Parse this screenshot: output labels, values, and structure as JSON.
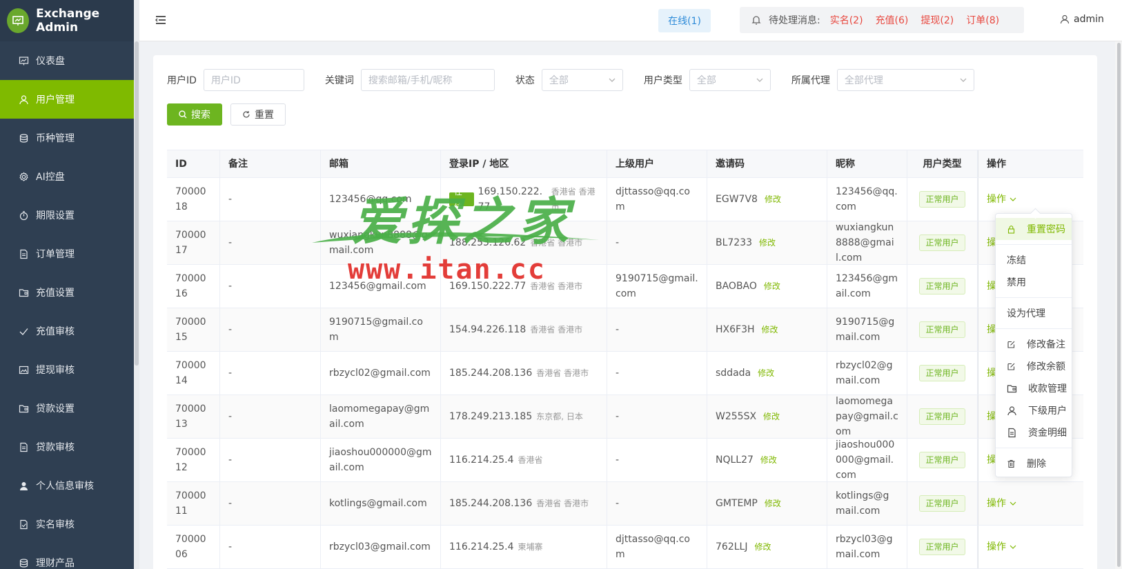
{
  "app": {
    "title": "Exchange Admin"
  },
  "sidebar": {
    "items": [
      {
        "label": "仪表盘",
        "icon": "dashboard-icon",
        "active": false
      },
      {
        "label": "用户管理",
        "icon": "user-icon",
        "active": true
      },
      {
        "label": "币种管理",
        "icon": "coin-icon",
        "active": false
      },
      {
        "label": "AI控盘",
        "icon": "gear-icon",
        "active": false
      },
      {
        "label": "期限设置",
        "icon": "stopwatch-icon",
        "active": false
      },
      {
        "label": "订单管理",
        "icon": "document-icon",
        "active": false
      },
      {
        "label": "充值设置",
        "icon": "folder-icon",
        "active": false
      },
      {
        "label": "充值审核",
        "icon": "check-icon",
        "active": false
      },
      {
        "label": "提现审核",
        "icon": "image-icon",
        "active": false
      },
      {
        "label": "贷款设置",
        "icon": "folder-icon",
        "active": false
      },
      {
        "label": "贷款审核",
        "icon": "document-icon",
        "active": false
      },
      {
        "label": "个人信息审核",
        "icon": "user-filled-icon",
        "active": false
      },
      {
        "label": "实名审核",
        "icon": "doc-check-icon",
        "active": false
      },
      {
        "label": "理财产品",
        "icon": "coin-icon",
        "active": false
      }
    ]
  },
  "header": {
    "online": "在线(1)",
    "notice_label": "待处理消息:",
    "notices": [
      "实名(2)",
      "充值(6)",
      "提现(2)",
      "订单(8)"
    ],
    "user": "admin"
  },
  "filters": {
    "user_id_label": "用户ID",
    "user_id_placeholder": "用户ID",
    "keyword_label": "关键词",
    "keyword_placeholder": "搜索邮箱/手机/昵称",
    "status_label": "状态",
    "status_value": "全部",
    "user_type_label": "用户类型",
    "user_type_value": "全部",
    "agent_label": "所属代理",
    "agent_value": "全部代理",
    "search_button": "搜索",
    "reset_button": "重置"
  },
  "table": {
    "headers": [
      "ID",
      "备注",
      "邮箱",
      "登录IP / 地区",
      "上级用户",
      "邀请码",
      "昵称",
      "用户类型",
      "操作"
    ],
    "edit_label": "修改",
    "ops_label": "操作",
    "rows": [
      {
        "id": "7000018",
        "note": "-",
        "email": "123456@qq.com",
        "online": "在线",
        "ip": "169.150.222.77",
        "region": "香港省 香港市",
        "parent": "djttasso@qq.com",
        "code": "EGW7V8",
        "nick": "123456@qq.com",
        "type": "正常用户"
      },
      {
        "id": "7000017",
        "note": "-",
        "email": "wuxiangkun8888@gmail.com",
        "online": "",
        "ip": "188.253.126.62",
        "region": "香港省 香港市",
        "parent": "-",
        "code": "BL7233",
        "nick": "wuxiangkun8888@gmail.com",
        "type": "正常用户"
      },
      {
        "id": "7000016",
        "note": "-",
        "email": "123456@gmail.com",
        "online": "",
        "ip": "169.150.222.77",
        "region": "香港省 香港市",
        "parent": "9190715@gmail.com",
        "code": "BAOBAO",
        "nick": "123456@gmail.com",
        "type": "正常用户"
      },
      {
        "id": "7000015",
        "note": "-",
        "email": "9190715@gmail.com",
        "online": "",
        "ip": "154.94.226.118",
        "region": "香港省 香港市",
        "parent": "-",
        "code": "HX6F3H",
        "nick": "9190715@gmail.com",
        "type": "正常用户"
      },
      {
        "id": "7000014",
        "note": "-",
        "email": "rbzycl02@gmail.com",
        "online": "",
        "ip": "185.244.208.136",
        "region": "香港省 香港市",
        "parent": "-",
        "code": "sddada",
        "nick": "rbzycl02@gmail.com",
        "type": "正常用户"
      },
      {
        "id": "7000013",
        "note": "-",
        "email": "laomomegapay@gmail.com",
        "online": "",
        "ip": "178.249.213.185",
        "region": "东京都, 日本",
        "parent": "-",
        "code": "W255SX",
        "nick": "laomomegapay@gmail.com",
        "type": "正常用户"
      },
      {
        "id": "7000012",
        "note": "-",
        "email": "jiaoshou000000@gmail.com",
        "online": "",
        "ip": "116.214.25.4",
        "region": "香港省",
        "parent": "-",
        "code": "NQLL27",
        "nick": "jiaoshou000000@gmail.com",
        "type": "正常用户"
      },
      {
        "id": "7000011",
        "note": "-",
        "email": "kotlings@gmail.com",
        "online": "",
        "ip": "185.244.208.136",
        "region": "香港省 香港市",
        "parent": "-",
        "code": "GMTEMP",
        "nick": "kotlings@gmail.com",
        "type": "正常用户"
      },
      {
        "id": "7000006",
        "note": "-",
        "email": "rbzycl03@gmail.com",
        "online": "",
        "ip": "116.214.25.4",
        "region": "柬埔寨",
        "parent": "djttasso@qq.com",
        "code": "762LLJ",
        "nick": "rbzycl03@gmail.com",
        "type": "正常用户"
      }
    ]
  },
  "dropdown": {
    "items": [
      {
        "label": "重置密码",
        "icon": "lock-icon",
        "highlight": true,
        "sep_after": true
      },
      {
        "label": "冻结",
        "icon": "",
        "highlight": false,
        "sep_after": false
      },
      {
        "label": "禁用",
        "icon": "",
        "highlight": false,
        "sep_after": true
      },
      {
        "label": "设为代理",
        "icon": "",
        "highlight": false,
        "sep_after": true
      },
      {
        "label": "修改备注",
        "icon": "edit-icon",
        "highlight": false,
        "sep_after": false
      },
      {
        "label": "修改余额",
        "icon": "edit-icon",
        "highlight": false,
        "sep_after": false
      },
      {
        "label": "收款管理",
        "icon": "folder-icon",
        "highlight": false,
        "sep_after": false
      },
      {
        "label": "下级用户",
        "icon": "user-icon",
        "highlight": false,
        "sep_after": false
      },
      {
        "label": "资金明细",
        "icon": "document-icon",
        "highlight": false,
        "sep_after": true
      },
      {
        "label": "删除",
        "icon": "trash-icon",
        "highlight": false,
        "sep_after": false
      }
    ]
  },
  "watermark": {
    "title": "爱探之家",
    "url": "www.itan.cc"
  },
  "colors": {
    "brand_green": "#7fba00",
    "sidebar_bg": "#2f3f52",
    "danger_red": "#e8473e",
    "info_blue": "#2c8ad8"
  }
}
